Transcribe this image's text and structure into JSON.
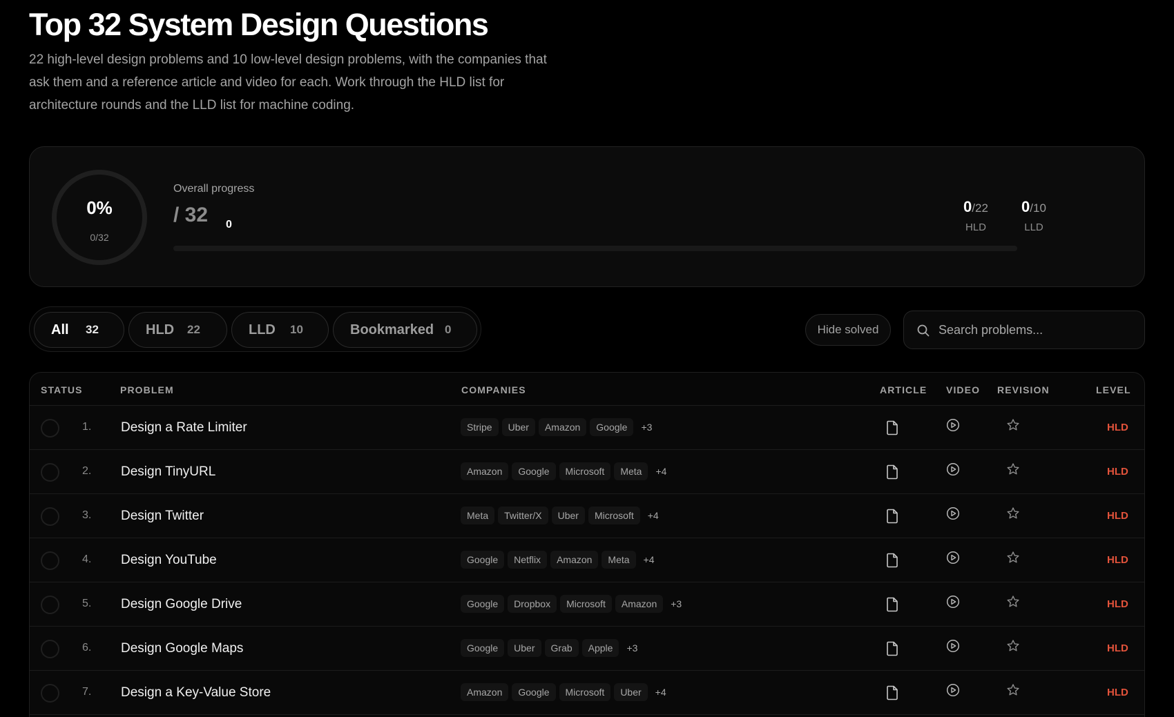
{
  "header": {
    "title": "Top 32 System Design Questions",
    "subtitle": "22 high-level design problems and 10 low-level design problems, with the companies that ask them and a reference article and video for each. Work through the HLD list for architecture rounds and the LLD list for machine coding."
  },
  "progress": {
    "ring_percent": "0%",
    "ring_sub": "0/32",
    "label": "Overall progress",
    "solved": "0",
    "separator": " / ",
    "total": "32",
    "fraction": 0,
    "hld": {
      "solved": "0",
      "total": "/22",
      "label": "HLD"
    },
    "lld": {
      "solved": "0",
      "total": "/10",
      "label": "LLD"
    }
  },
  "tabs": [
    {
      "label": "All",
      "count": "32",
      "active": true
    },
    {
      "label": "HLD",
      "count": "22",
      "active": false
    },
    {
      "label": "LLD",
      "count": "10",
      "active": false
    },
    {
      "label": "Bookmarked",
      "count": "0",
      "active": false
    }
  ],
  "hide_solved_label": "Hide solved",
  "search": {
    "placeholder": "Search problems..."
  },
  "table": {
    "headers": {
      "status": "STATUS",
      "problem": "PROBLEM",
      "companies": "COMPANIES",
      "article": "ARTICLE",
      "video": "VIDEO",
      "revision": "REVISION",
      "level": "LEVEL"
    },
    "rows": [
      {
        "num": "1.",
        "name": "Design a Rate Limiter",
        "companies": [
          "Stripe",
          "Uber",
          "Amazon",
          "Google"
        ],
        "more": "+3",
        "level": "HLD"
      },
      {
        "num": "2.",
        "name": "Design TinyURL",
        "companies": [
          "Amazon",
          "Google",
          "Microsoft",
          "Meta"
        ],
        "more": "+4",
        "level": "HLD"
      },
      {
        "num": "3.",
        "name": "Design Twitter",
        "companies": [
          "Meta",
          "Twitter/X",
          "Uber",
          "Microsoft"
        ],
        "more": "+4",
        "level": "HLD"
      },
      {
        "num": "4.",
        "name": "Design YouTube",
        "companies": [
          "Google",
          "Netflix",
          "Amazon",
          "Meta"
        ],
        "more": "+4",
        "level": "HLD"
      },
      {
        "num": "5.",
        "name": "Design Google Drive",
        "companies": [
          "Google",
          "Dropbox",
          "Microsoft",
          "Amazon"
        ],
        "more": "+3",
        "level": "HLD"
      },
      {
        "num": "6.",
        "name": "Design Google Maps",
        "companies": [
          "Google",
          "Uber",
          "Grab",
          "Apple"
        ],
        "more": "+3",
        "level": "HLD"
      },
      {
        "num": "7.",
        "name": "Design a Key-Value Store",
        "companies": [
          "Amazon",
          "Google",
          "Microsoft",
          "Uber"
        ],
        "more": "+4",
        "level": "HLD"
      }
    ]
  },
  "icons": {
    "article": "document-icon",
    "video": "play-circle-icon",
    "revision": "star-icon",
    "search": "search-icon"
  },
  "colors": {
    "accent": "#e3533b",
    "background": "#000000"
  }
}
